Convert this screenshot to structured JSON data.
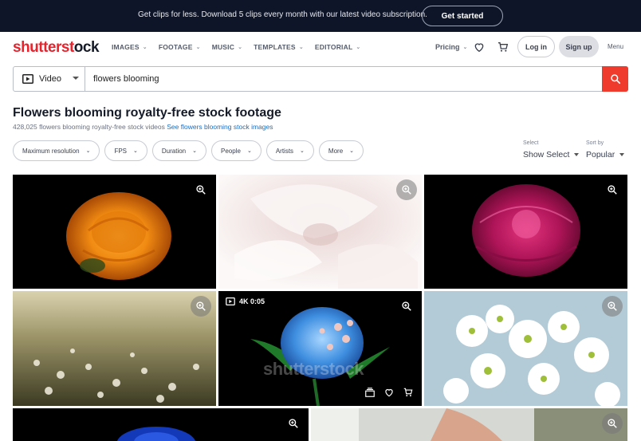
{
  "promo": {
    "text": "Get clips for less. Download 5 clips every month with our latest video subscription.",
    "cta": "Get started"
  },
  "nav": {
    "logo_part1": "shutterst",
    "logo_part2": "ck",
    "links": [
      "IMAGES",
      "FOOTAGE",
      "MUSIC",
      "TEMPLATES",
      "EDITORIAL"
    ],
    "pricing": "Pricing",
    "login": "Log in",
    "signup": "Sign up",
    "menu": "Menu"
  },
  "search": {
    "type": "Video",
    "query": "flowers blooming",
    "icons": {
      "type": "video-icon",
      "submit": "search-icon"
    }
  },
  "results": {
    "title": "Flowers blooming royalty-free stock footage",
    "count_text": "428,025 flowers blooming royalty-free stock videos",
    "link_text": "See flowers blooming stock images"
  },
  "filters": [
    "Maximum resolution",
    "FPS",
    "Duration",
    "People",
    "Artists",
    "More"
  ],
  "selects": {
    "select": {
      "caption": "Select",
      "value": "Show Select"
    },
    "sort": {
      "caption": "Sort by",
      "value": "Popular"
    }
  },
  "tiles": [
    {
      "subject": "orange rose on black"
    },
    {
      "subject": "white petals close-up"
    },
    {
      "subject": "magenta peony on black"
    },
    {
      "subject": "meadow of white flowers"
    },
    {
      "subject": "blue peony blooming",
      "badge": "4K 0:05",
      "watermark": "shutterstock"
    },
    {
      "subject": "white cherry blossoms"
    },
    {
      "subject": "blue flower on black"
    },
    {
      "subject": "hand over white flowers"
    }
  ],
  "colors": {
    "brand_red": "#e9222c",
    "promo_bg": "#0e1528",
    "link_blue": "#1b6ec2",
    "search_btn": "#ef3b2e"
  }
}
